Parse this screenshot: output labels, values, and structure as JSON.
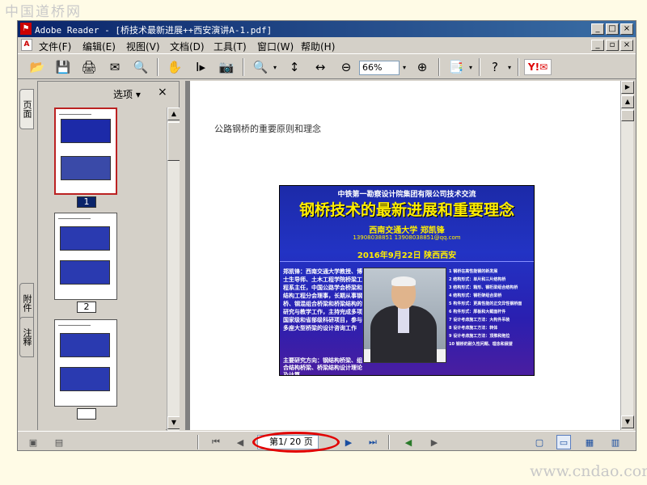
{
  "watermarks": {
    "top": "中国道桥网",
    "bottom": "www.cndao.com"
  },
  "window": {
    "title": "Adobe Reader - [桥技术最新进展++西安演讲A-1.pdf]",
    "buttons": [
      "_",
      "□",
      "×"
    ]
  },
  "menu": {
    "items": [
      "文件(F)",
      "编辑(E)",
      "视图(V)",
      "文档(D)",
      "工具(T)",
      "窗口(W)",
      "帮助(H)"
    ],
    "doc_buttons": [
      "_",
      "▫",
      "×"
    ]
  },
  "toolbar": {
    "zoom_value": "66%",
    "yahoo_label": "Y!✉",
    "glyphs": {
      "open": "📂",
      "save": "💾",
      "print": "🖨",
      "email": "✉",
      "search": "🔍",
      "hand": "✋",
      "select": "I▸",
      "snapshot": "📷",
      "zoom_in": "🔍",
      "fit_page": "↕",
      "fit_width": "↔",
      "zoom_minus": "⊖",
      "zoom_plus": "⊕",
      "dropdown": "▾",
      "tasks": "📑",
      "help": "?"
    }
  },
  "side_tabs": {
    "pages": "页面",
    "attachments": "附件",
    "comments": "注释"
  },
  "thumbnail_pane": {
    "options_label": "选项",
    "options_arrow": "▾",
    "close_label": "×",
    "scroll_up": "▲",
    "scroll_down": "▼",
    "pages": [
      "1",
      "2",
      ""
    ]
  },
  "document": {
    "page_header": "公路钢桥的重要原则和理念",
    "slide": {
      "org": "中铁第一勘察设计院集团有限公司技术交流",
      "title": "钢桥技术的最新进展和重要理念",
      "author": "西南交通大学  郑凯锋",
      "contact": "13908038851  13908038851@qq.com",
      "date": "2016年9月22日  陕西西安",
      "left_text": "郑凯锋：西南交通大学教授、博士生导师、土木工程学院桥梁工程系主任，中国公路学会桥梁和结构工程分会理事，长期从事钢桥、钢混组合桥梁和桥梁结构的研究与教学工作，主持完成多项国家级和省部级科研项目，参与多座大型桥梁的设计咨询工作",
      "left_text_2": "主要研究方向：钢结构桥梁、组合结构桥梁、桥梁结构设计理论及计算",
      "bullets": [
        "1 钢桥在高性能钢的新发展",
        "2 结构形式：单片和三片结构桥",
        "3 结构形式：箱形、钢桁梁组合结构桥",
        "4 结构形式：钢桁架组合梁桥",
        "5 构件形式：更高性能的正交异性钢桥面",
        "6 构件形式：厚板和大截面杆件",
        "7 设计考虑施工方法：大构件吊装",
        "8 设计考虑施工方法：转体",
        "9 设计考虑施工方法：顶推和拖拉",
        "10 钢桥的耐久性问题、理念和展望"
      ]
    },
    "scroll_up": "▲",
    "scroll_down": "▼",
    "scroll_right": "▶"
  },
  "statusbar": {
    "page_field": "第1/ 20 页",
    "glyphs": {
      "first": "⏮",
      "prev": "◀",
      "next": "▶",
      "last": "⏭",
      "back": "◀",
      "forward": "▶",
      "single": "▢",
      "continuous": "▭",
      "facing": "▦",
      "cont_facing": "▥",
      "left1": "▣",
      "left2": "▤"
    }
  },
  "colors": {
    "title_bar": "#0a246a",
    "slide_bg": "#2233c4",
    "slide_title": "#ffee00",
    "highlight_oval": "#e20000"
  }
}
